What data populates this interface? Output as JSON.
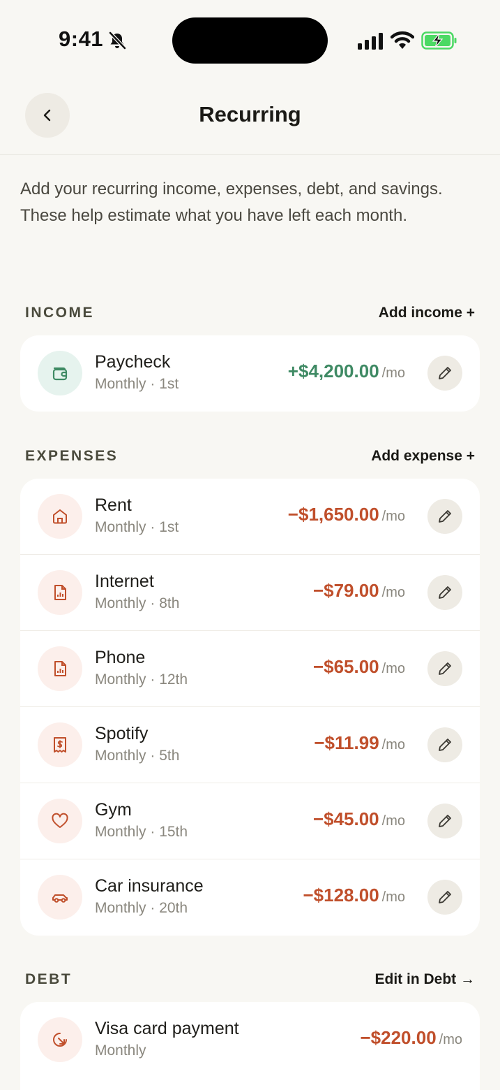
{
  "status_bar": {
    "time": "9:41"
  },
  "header": {
    "title": "Recurring"
  },
  "intro": "Add your recurring income, expenses, debt, and savings. These help estimate what you have left each month.",
  "colors": {
    "income": "#3f8a64",
    "expense": "#c04f2b",
    "background": "#f8f7f3"
  },
  "income": {
    "label": "INCOME",
    "action": "Add income +",
    "items": [
      {
        "icon": "wallet-icon",
        "name": "Paycheck",
        "schedule": "Monthly · 1st",
        "amount": "+$4,200.00",
        "unit": "/mo"
      }
    ]
  },
  "expenses": {
    "label": "EXPENSES",
    "action": "Add expense +",
    "items": [
      {
        "icon": "home-icon",
        "name": "Rent",
        "schedule": "Monthly · 1st",
        "amount": "−$1,650.00",
        "unit": "/mo"
      },
      {
        "icon": "bill-icon",
        "name": "Internet",
        "schedule": "Monthly · 8th",
        "amount": "−$79.00",
        "unit": "/mo"
      },
      {
        "icon": "bill-icon",
        "name": "Phone",
        "schedule": "Monthly · 12th",
        "amount": "−$65.00",
        "unit": "/mo"
      },
      {
        "icon": "receipt-icon",
        "name": "Spotify",
        "schedule": "Monthly · 5th",
        "amount": "−$11.99",
        "unit": "/mo"
      },
      {
        "icon": "heart-icon",
        "name": "Gym",
        "schedule": "Monthly · 15th",
        "amount": "−$45.00",
        "unit": "/mo"
      },
      {
        "icon": "car-icon",
        "name": "Car insurance",
        "schedule": "Monthly · 20th",
        "amount": "−$128.00",
        "unit": "/mo"
      }
    ]
  },
  "debt": {
    "label": "DEBT",
    "action": "Edit in Debt →",
    "items": [
      {
        "icon": "payment-icon",
        "name": "Visa card payment",
        "schedule": "Monthly",
        "amount": "−$220.00",
        "unit": "/mo"
      }
    ]
  }
}
